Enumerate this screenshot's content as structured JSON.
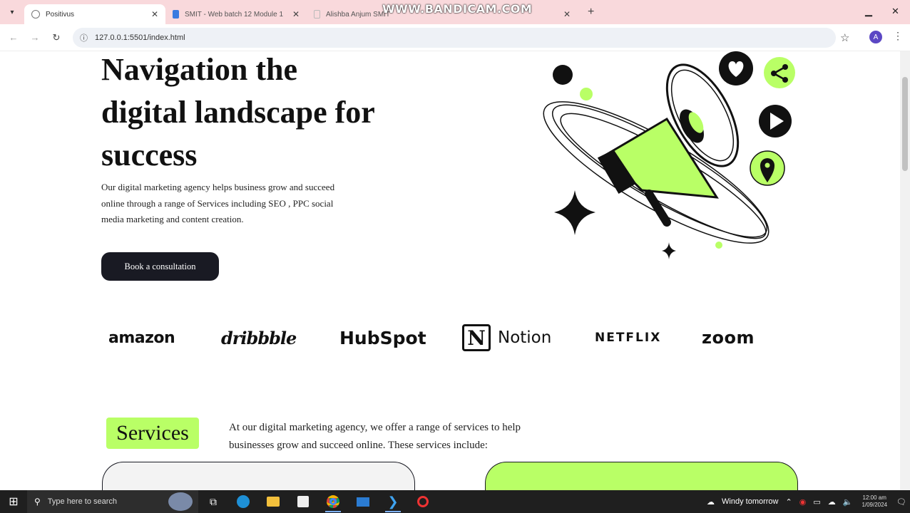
{
  "browser": {
    "tabs": [
      {
        "title": "Positivus",
        "active": true
      },
      {
        "title": "SMIT - Web batch 12 Module 1",
        "active": false
      },
      {
        "title": "Alishba Anjum SMIT",
        "active": false
      }
    ],
    "url": "127.0.0.1:5501/index.html",
    "profile_initial": "A",
    "watermark": "WWW.BANDICAM.COM"
  },
  "hero": {
    "title": "Navigation the digital landscape for success",
    "description": "Our digital marketing agency helps business grow and succeed online through a range of Services including SEO , PPC social media marketing and content creation.",
    "cta_label": "Book a consultation"
  },
  "logos": [
    "amazon",
    "dribbble",
    "HubSpot",
    "Notion",
    "NETFLIX",
    "zoom"
  ],
  "services": {
    "badge": "Services",
    "text": "At our digital marketing agency, we offer a range of services to help businesses grow and succeed online. These services include:"
  },
  "taskbar": {
    "search_placeholder": "Type here to search",
    "weather": "Windy tomorrow",
    "time": "12:00 am",
    "date": "1/09/2024"
  },
  "colors": {
    "accent": "#b9ff66",
    "dark": "#191a23",
    "tab_bar": "#f9d9dc"
  }
}
